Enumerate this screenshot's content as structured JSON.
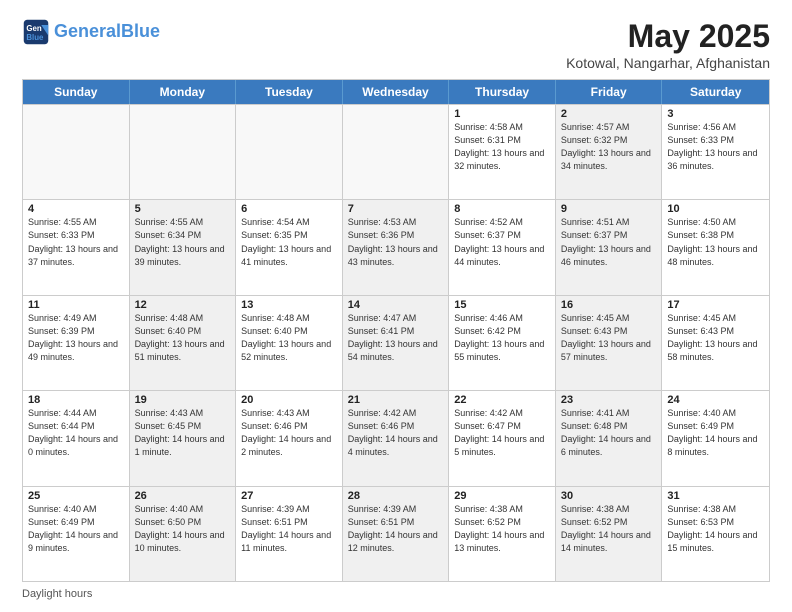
{
  "header": {
    "logo_general": "General",
    "logo_blue": "Blue",
    "title": "May 2025",
    "subtitle": "Kotowal, Nangarhar, Afghanistan"
  },
  "days_of_week": [
    "Sunday",
    "Monday",
    "Tuesday",
    "Wednesday",
    "Thursday",
    "Friday",
    "Saturday"
  ],
  "weeks": [
    [
      {
        "day": "",
        "empty": true
      },
      {
        "day": "",
        "empty": true
      },
      {
        "day": "",
        "empty": true
      },
      {
        "day": "",
        "empty": true
      },
      {
        "day": "1",
        "text": "Sunrise: 4:58 AM\nSunset: 6:31 PM\nDaylight: 13 hours\nand 32 minutes.",
        "shaded": false
      },
      {
        "day": "2",
        "text": "Sunrise: 4:57 AM\nSunset: 6:32 PM\nDaylight: 13 hours\nand 34 minutes.",
        "shaded": true
      },
      {
        "day": "3",
        "text": "Sunrise: 4:56 AM\nSunset: 6:33 PM\nDaylight: 13 hours\nand 36 minutes.",
        "shaded": false
      }
    ],
    [
      {
        "day": "4",
        "text": "Sunrise: 4:55 AM\nSunset: 6:33 PM\nDaylight: 13 hours\nand 37 minutes.",
        "shaded": false
      },
      {
        "day": "5",
        "text": "Sunrise: 4:55 AM\nSunset: 6:34 PM\nDaylight: 13 hours\nand 39 minutes.",
        "shaded": true
      },
      {
        "day": "6",
        "text": "Sunrise: 4:54 AM\nSunset: 6:35 PM\nDaylight: 13 hours\nand 41 minutes.",
        "shaded": false
      },
      {
        "day": "7",
        "text": "Sunrise: 4:53 AM\nSunset: 6:36 PM\nDaylight: 13 hours\nand 43 minutes.",
        "shaded": true
      },
      {
        "day": "8",
        "text": "Sunrise: 4:52 AM\nSunset: 6:37 PM\nDaylight: 13 hours\nand 44 minutes.",
        "shaded": false
      },
      {
        "day": "9",
        "text": "Sunrise: 4:51 AM\nSunset: 6:37 PM\nDaylight: 13 hours\nand 46 minutes.",
        "shaded": true
      },
      {
        "day": "10",
        "text": "Sunrise: 4:50 AM\nSunset: 6:38 PM\nDaylight: 13 hours\nand 48 minutes.",
        "shaded": false
      }
    ],
    [
      {
        "day": "11",
        "text": "Sunrise: 4:49 AM\nSunset: 6:39 PM\nDaylight: 13 hours\nand 49 minutes.",
        "shaded": false
      },
      {
        "day": "12",
        "text": "Sunrise: 4:48 AM\nSunset: 6:40 PM\nDaylight: 13 hours\nand 51 minutes.",
        "shaded": true
      },
      {
        "day": "13",
        "text": "Sunrise: 4:48 AM\nSunset: 6:40 PM\nDaylight: 13 hours\nand 52 minutes.",
        "shaded": false
      },
      {
        "day": "14",
        "text": "Sunrise: 4:47 AM\nSunset: 6:41 PM\nDaylight: 13 hours\nand 54 minutes.",
        "shaded": true
      },
      {
        "day": "15",
        "text": "Sunrise: 4:46 AM\nSunset: 6:42 PM\nDaylight: 13 hours\nand 55 minutes.",
        "shaded": false
      },
      {
        "day": "16",
        "text": "Sunrise: 4:45 AM\nSunset: 6:43 PM\nDaylight: 13 hours\nand 57 minutes.",
        "shaded": true
      },
      {
        "day": "17",
        "text": "Sunrise: 4:45 AM\nSunset: 6:43 PM\nDaylight: 13 hours\nand 58 minutes.",
        "shaded": false
      }
    ],
    [
      {
        "day": "18",
        "text": "Sunrise: 4:44 AM\nSunset: 6:44 PM\nDaylight: 14 hours\nand 0 minutes.",
        "shaded": false
      },
      {
        "day": "19",
        "text": "Sunrise: 4:43 AM\nSunset: 6:45 PM\nDaylight: 14 hours\nand 1 minute.",
        "shaded": true
      },
      {
        "day": "20",
        "text": "Sunrise: 4:43 AM\nSunset: 6:46 PM\nDaylight: 14 hours\nand 2 minutes.",
        "shaded": false
      },
      {
        "day": "21",
        "text": "Sunrise: 4:42 AM\nSunset: 6:46 PM\nDaylight: 14 hours\nand 4 minutes.",
        "shaded": true
      },
      {
        "day": "22",
        "text": "Sunrise: 4:42 AM\nSunset: 6:47 PM\nDaylight: 14 hours\nand 5 minutes.",
        "shaded": false
      },
      {
        "day": "23",
        "text": "Sunrise: 4:41 AM\nSunset: 6:48 PM\nDaylight: 14 hours\nand 6 minutes.",
        "shaded": true
      },
      {
        "day": "24",
        "text": "Sunrise: 4:40 AM\nSunset: 6:49 PM\nDaylight: 14 hours\nand 8 minutes.",
        "shaded": false
      }
    ],
    [
      {
        "day": "25",
        "text": "Sunrise: 4:40 AM\nSunset: 6:49 PM\nDaylight: 14 hours\nand 9 minutes.",
        "shaded": false
      },
      {
        "day": "26",
        "text": "Sunrise: 4:40 AM\nSunset: 6:50 PM\nDaylight: 14 hours\nand 10 minutes.",
        "shaded": true
      },
      {
        "day": "27",
        "text": "Sunrise: 4:39 AM\nSunset: 6:51 PM\nDaylight: 14 hours\nand 11 minutes.",
        "shaded": false
      },
      {
        "day": "28",
        "text": "Sunrise: 4:39 AM\nSunset: 6:51 PM\nDaylight: 14 hours\nand 12 minutes.",
        "shaded": true
      },
      {
        "day": "29",
        "text": "Sunrise: 4:38 AM\nSunset: 6:52 PM\nDaylight: 14 hours\nand 13 minutes.",
        "shaded": false
      },
      {
        "day": "30",
        "text": "Sunrise: 4:38 AM\nSunset: 6:52 PM\nDaylight: 14 hours\nand 14 minutes.",
        "shaded": true
      },
      {
        "day": "31",
        "text": "Sunrise: 4:38 AM\nSunset: 6:53 PM\nDaylight: 14 hours\nand 15 minutes.",
        "shaded": false
      }
    ]
  ],
  "footer": {
    "daylight_label": "Daylight hours"
  }
}
